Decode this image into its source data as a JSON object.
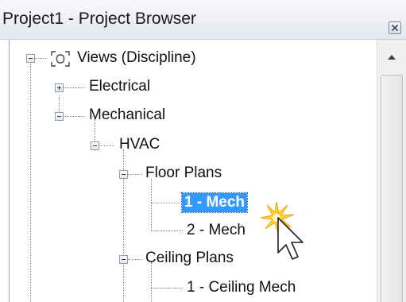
{
  "window": {
    "title": "Project1 - Project Browser",
    "close_icon": "close-icon"
  },
  "tree": {
    "root": {
      "label": "Views (Discipline)",
      "icon": "views-icon",
      "expanded": true
    },
    "electrical": {
      "label": "Electrical",
      "expanded": false
    },
    "mechanical": {
      "label": "Mechanical",
      "expanded": true
    },
    "hvac": {
      "label": "HVAC",
      "expanded": true
    },
    "floor_plans": {
      "label": "Floor Plans",
      "expanded": true
    },
    "floor_plan_items": [
      {
        "label": "1 - Mech",
        "selected": true
      },
      {
        "label": "2 - Mech",
        "selected": false
      }
    ],
    "ceiling_plans": {
      "label": "Ceiling Plans",
      "expanded": true
    },
    "ceiling_plan_items": [
      {
        "label": "1 - Ceiling Mech",
        "selected": false
      }
    ]
  },
  "colors": {
    "selection": "#3399ff",
    "title_bar": "#e3e7ee"
  }
}
